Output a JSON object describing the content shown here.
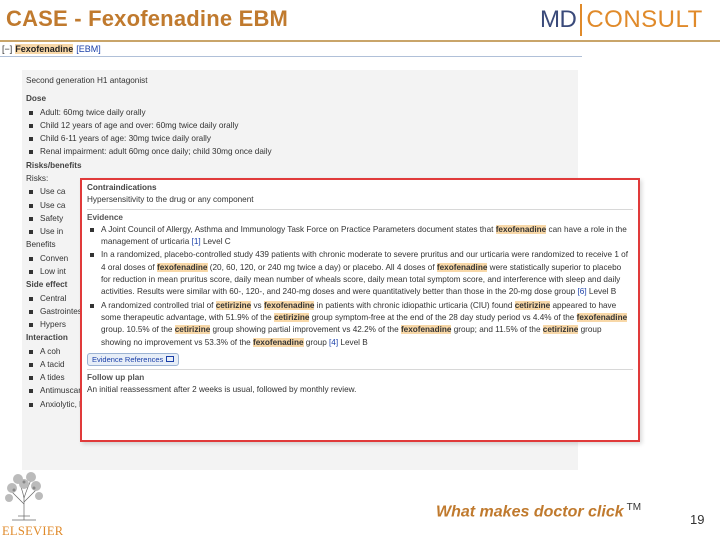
{
  "slide": {
    "title": "CASE - Fexofenadine EBM",
    "tagline": "What makes doctor click",
    "trademark": "TM",
    "page_number": "19"
  },
  "logo": {
    "md": "MD",
    "consult": "CONSULT"
  },
  "publisher": {
    "name": "ELSEVIER"
  },
  "topic_bar": {
    "toggle": "[−]",
    "drug": "Fexofenadine",
    "ebm_link": "[EBM]"
  },
  "drug_info": {
    "intro": "Second generation H1 antagonist",
    "dose_heading": "Dose",
    "dose_items": [
      "Adult: 60mg twice daily orally",
      "Child 12 years of age and over: 60mg twice daily orally",
      "Child 6-11 years of age: 30mg twice daily orally",
      "Renal impairment: adult 60mg once daily; child 30mg once daily"
    ],
    "risks_heading": "Risks/benefits",
    "risks_sub": "Risks:",
    "risks_items": [
      "Use ca",
      "Use ca",
      "Safety",
      "Use in"
    ],
    "benefits_heading": "Benefits",
    "benefits_items": [
      "Conven",
      "Low int"
    ],
    "side_effects_heading": "Side effect",
    "side_effects_items": [
      "Central",
      "Gastrointestinal",
      "Hypers"
    ],
    "interactions_heading": "Interaction",
    "interactions_items": [
      "A coh",
      "A tacid",
      "A tides",
      "Antimuscarinics",
      "Anxiolytic, hypnotics"
    ]
  },
  "popup": {
    "contraindications_heading": "Contraindications",
    "contraindications_text": "Hypersensitivity to the drug or any component",
    "evidence_heading": "Evidence",
    "evidence_items": [
      [
        {
          "t": "A Joint Council of Allergy, Asthma and Immunology Task Force on Practice Parameters document states that "
        },
        {
          "t": "fexofenadine",
          "hl": true
        },
        {
          "t": " can have a role in the management of urticaria "
        },
        {
          "t": "[1]",
          "link": true
        },
        {
          "t": " Level C"
        }
      ],
      [
        {
          "t": "In a randomized, placebo-controlled study 439 patients with chronic moderate to severe pruritus and our urticaria were randomized to receive 1 of 4 oral doses of "
        },
        {
          "t": "fexofenadine",
          "hl": true
        },
        {
          "t": " (20, 60, 120, or 240 mg twice a day) or placebo. All 4 doses of "
        },
        {
          "t": "fexofenadine",
          "hl": true
        },
        {
          "t": " were statistically superior to placebo for reduction in mean pruritus score, daily mean number of wheals score, daily mean total symptom score, and interference with sleep and daily activities. Results were similar with 60-, 120-, and 240-mg doses and were quantitatively better than those in the 20-mg dose group "
        },
        {
          "t": "[6]",
          "link": true
        },
        {
          "t": " Level B"
        }
      ],
      [
        {
          "t": "A randomized controlled trial of "
        },
        {
          "t": "cetirizine",
          "hl": true
        },
        {
          "t": " vs "
        },
        {
          "t": "fexofenadine",
          "hl": true
        },
        {
          "t": " in patients with chronic idiopathic urticaria (CIU) found "
        },
        {
          "t": "cetirizine",
          "hl": true
        },
        {
          "t": " appeared to have some therapeutic advantage, with 51.9% of the "
        },
        {
          "t": "cetirizine",
          "hl": true
        },
        {
          "t": " group symptom-free at the end of the 28 day study period vs 4.4% of the "
        },
        {
          "t": "fexofenadine",
          "hl": true
        },
        {
          "t": " group. 10.5% of the "
        },
        {
          "t": "cetirizine",
          "hl": true
        },
        {
          "t": " group showing partial improvement vs 42.2% of the "
        },
        {
          "t": "fexofenadine",
          "hl": true
        },
        {
          "t": " group; and 11.5% of the "
        },
        {
          "t": "cetirizine",
          "hl": true
        },
        {
          "t": " group showing no improvement vs 53.3% of the "
        },
        {
          "t": "fexofenadine",
          "hl": true
        },
        {
          "t": " group "
        },
        {
          "t": "[4]",
          "link": true
        },
        {
          "t": " Level B"
        }
      ]
    ],
    "evidence_refs_label": "Evidence References",
    "follow_up_heading": "Follow up plan",
    "follow_up_text": "An initial reassessment after 2 weeks is usual, followed by monthly review."
  },
  "colors": {
    "title_orange": "#c07a2e",
    "highlight": "#f8d8a8",
    "popup_border": "#e03a3a",
    "link_blue": "#1a3fa8",
    "md_navy": "#3a4a7a"
  }
}
